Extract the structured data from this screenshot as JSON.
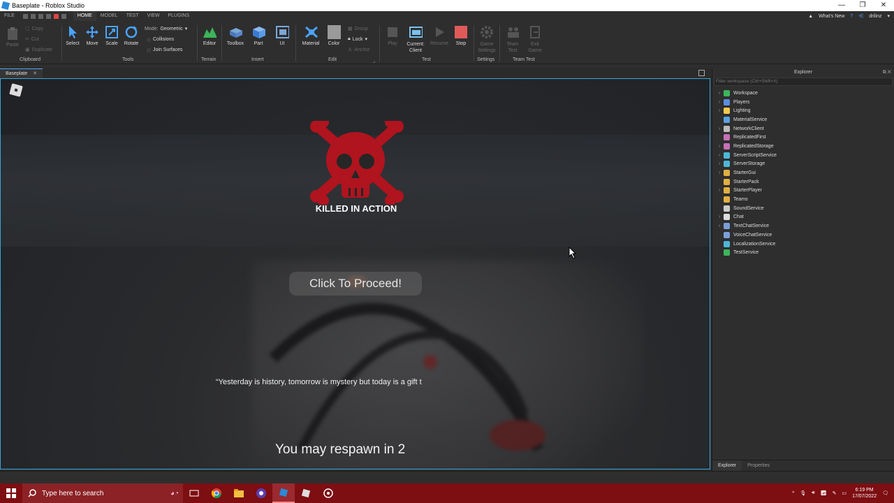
{
  "window": {
    "title": "Baseplate - Roblox Studio",
    "controls": [
      "—",
      "❐",
      "✕"
    ]
  },
  "menubar": {
    "tabs": [
      "FILE",
      "HOME",
      "MODEL",
      "TEST",
      "VIEW",
      "PLUGINS"
    ],
    "active_tab": "HOME",
    "whats_new": "What's New",
    "user": "drilinz"
  },
  "ribbon": {
    "clipboard": {
      "paste": "Paste",
      "copy": "Copy",
      "cut": "Cut",
      "duplicate": "Duplicate",
      "label": "Clipboard"
    },
    "tools": {
      "select": "Select",
      "move": "Move",
      "scale": "Scale",
      "rotate": "Rotate",
      "mode_label": "Mode:",
      "mode_value": "Geometric",
      "collisions": "Collisions",
      "join_surfaces": "Join Surfaces",
      "label": "Tools"
    },
    "terrain": {
      "editor": "Editor",
      "label": "Terrain"
    },
    "insert": {
      "toolbox": "Toolbox",
      "part": "Part",
      "ui": "UI",
      "label": "Insert"
    },
    "edit": {
      "material": "Material",
      "color": "Color",
      "group": "Group",
      "lock": "Lock",
      "anchor": "Anchor",
      "label": "Edit"
    },
    "test": {
      "play": "Play",
      "current_client": "Current:\nClient",
      "current_line1": "Current:",
      "current_line2": "Client",
      "resume": "Resume",
      "stop": "Stop",
      "label": "Test"
    },
    "settings": {
      "game_settings_1": "Game",
      "game_settings_2": "Settings",
      "label": "Settings"
    },
    "team_test": {
      "team_test_1": "Team",
      "team_test_2": "Test",
      "exit_game_1": "Exit",
      "exit_game_2": "Game",
      "label": "Team Test"
    }
  },
  "viewport": {
    "tab_label": "Baseplate",
    "tab_close": "✕",
    "death_title": "KILLED IN ACTION",
    "proceed_button": "Click To Proceed!",
    "quote": "“Yesterday is history, tomorrow is mystery but today is a gift t",
    "respawn": "You may respawn in 2",
    "accent_color": "#b0141e"
  },
  "explorer": {
    "title": "Explorer",
    "filter_placeholder": "Filter workspace (Ctrl+Shift+X)",
    "items": [
      {
        "label": "Workspace",
        "expandable": true,
        "color": "#3cb55a"
      },
      {
        "label": "Players",
        "expandable": true,
        "color": "#5a8de0"
      },
      {
        "label": "Lighting",
        "expandable": true,
        "color": "#f2c94c"
      },
      {
        "label": "MaterialService",
        "expandable": false,
        "color": "#5aa0e0"
      },
      {
        "label": "NetworkClient",
        "expandable": true,
        "color": "#bbbbbb"
      },
      {
        "label": "ReplicatedFirst",
        "expandable": false,
        "color": "#c86fb5"
      },
      {
        "label": "ReplicatedStorage",
        "expandable": true,
        "color": "#c86fb5"
      },
      {
        "label": "ServerScriptService",
        "expandable": true,
        "color": "#4cb7d8"
      },
      {
        "label": "ServerStorage",
        "expandable": true,
        "color": "#4cb7d8"
      },
      {
        "label": "StarterGui",
        "expandable": true,
        "color": "#e0b040"
      },
      {
        "label": "StarterPack",
        "expandable": false,
        "color": "#e0b040"
      },
      {
        "label": "StarterPlayer",
        "expandable": true,
        "color": "#e0b040"
      },
      {
        "label": "Teams",
        "expandable": false,
        "color": "#e0b040"
      },
      {
        "label": "SoundService",
        "expandable": false,
        "color": "#cccccc"
      },
      {
        "label": "Chat",
        "expandable": true,
        "color": "#dddddd"
      },
      {
        "label": "TextChatService",
        "expandable": true,
        "color": "#7a9fd8"
      },
      {
        "label": "VoiceChatService",
        "expandable": false,
        "color": "#7a9fd8"
      },
      {
        "label": "LocalizationService",
        "expandable": false,
        "color": "#4cb7d8"
      },
      {
        "label": "TestService",
        "expandable": false,
        "color": "#3cb55a"
      }
    ],
    "bottom_tabs": [
      "Explorer",
      "Properties"
    ]
  },
  "taskbar": {
    "search_placeholder": "Type here to search",
    "time": "6:19 PM",
    "date": "17/07/2022",
    "background": "#7d0e12"
  }
}
